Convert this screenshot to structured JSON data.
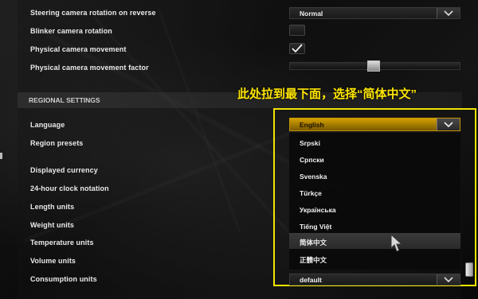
{
  "settings": {
    "steering_rotation": {
      "label": "Steering camera rotation on reverse",
      "value": "Normal"
    },
    "blinker_rotation": {
      "label": "Blinker camera rotation"
    },
    "physical_movement": {
      "label": "Physical camera movement"
    },
    "physical_factor": {
      "label": "Physical camera movement factor",
      "slider_value": 0.47
    }
  },
  "section": {
    "title": "REGIONAL SETTINGS"
  },
  "regional_rows": {
    "language": "Language",
    "region_presets": "Region presets",
    "currency": "Displayed currency",
    "clock": "24-hour clock notation",
    "length": "Length units",
    "weight": "Weight units",
    "temperature": "Temperature units",
    "volume": "Volume units",
    "consumption": "Consumption units"
  },
  "language_dropdown": {
    "selected": "English",
    "options": [
      "Srpski",
      "Српски",
      "Svenska",
      "Türkçe",
      "Українська",
      "Tiếng Việt",
      "简体中文",
      "正體中文"
    ],
    "hovered_index": 6
  },
  "consumption_value": "default",
  "annotation": {
    "text": "此处拉到最下面，选择“简体中文”",
    "color": "#ffe600"
  },
  "colors": {
    "accent": "#d2a000",
    "highlight_border": "#f2e400"
  }
}
